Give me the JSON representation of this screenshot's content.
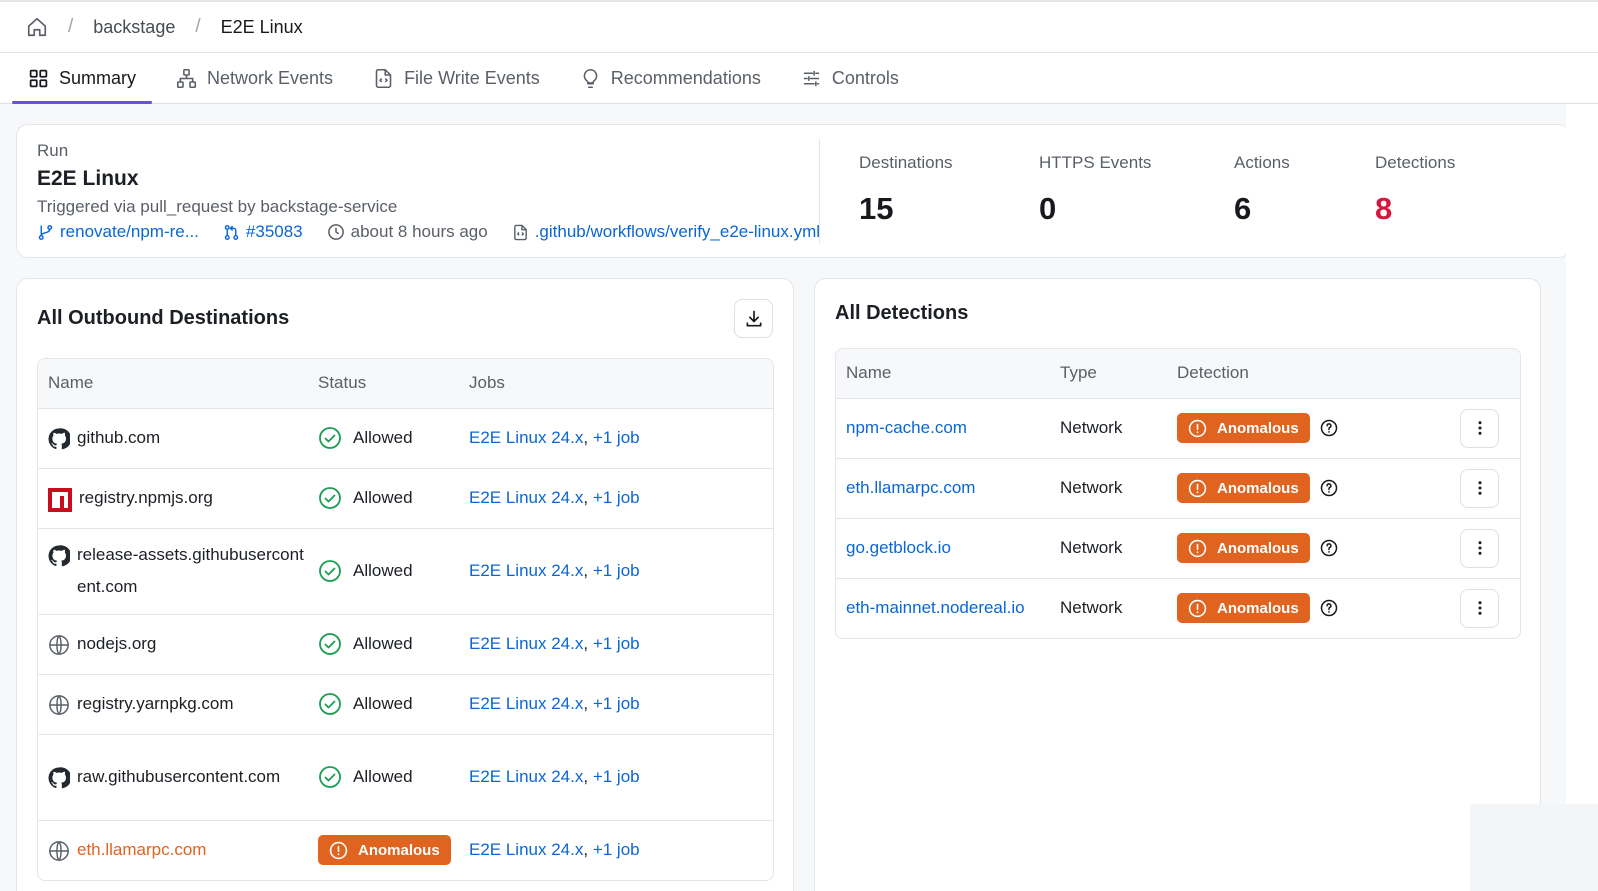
{
  "breadcrumb": {
    "items": [
      "backstage",
      "E2E Linux"
    ],
    "separator": "/"
  },
  "tabs": [
    {
      "label": "Summary",
      "icon": "grid-icon",
      "active": true
    },
    {
      "label": "Network Events",
      "icon": "network-icon",
      "active": false
    },
    {
      "label": "File Write Events",
      "icon": "file-code-icon",
      "active": false
    },
    {
      "label": "Recommendations",
      "icon": "lightbulb-icon",
      "active": false
    },
    {
      "label": "Controls",
      "icon": "sliders-icon",
      "active": false
    }
  ],
  "run": {
    "label": "Run",
    "title": "E2E Linux",
    "trigger": "Triggered via pull_request by backstage-service",
    "branch": "renovate/npm-re...",
    "pr": "#35083",
    "time": "about 8 hours ago",
    "workflow": ".github/workflows/verify_e2e-linux.yml"
  },
  "stats": [
    {
      "label": "Destinations",
      "value": "15",
      "color": "#17191d"
    },
    {
      "label": "HTTPS Events",
      "value": "0",
      "color": "#17191d"
    },
    {
      "label": "Actions",
      "value": "6",
      "color": "#17191d"
    },
    {
      "label": "Detections",
      "value": "8",
      "color": "#d4183d"
    }
  ],
  "destinations": {
    "title": "All Outbound Destinations",
    "columns": [
      "Name",
      "Status",
      "Jobs"
    ],
    "rows": [
      {
        "name": "github.com",
        "icon": "github-icon",
        "status": "Allowed",
        "job": "E2E Linux 24.x",
        "more": "+1 job"
      },
      {
        "name": "registry.npmjs.org",
        "icon": "npm-icon",
        "status": "Allowed",
        "job": "E2E Linux 24.x",
        "more": "+1 job"
      },
      {
        "name": "release-assets.githubusercontent.com",
        "icon": "github-icon",
        "status": "Allowed",
        "job": "E2E Linux 24.x",
        "more": "+1 job"
      },
      {
        "name": "nodejs.org",
        "icon": "globe-icon",
        "status": "Allowed",
        "job": "E2E Linux 24.x",
        "more": "+1 job"
      },
      {
        "name": "registry.yarnpkg.com",
        "icon": "globe-icon",
        "status": "Allowed",
        "job": "E2E Linux 24.x",
        "more": "+1 job"
      },
      {
        "name": "raw.githubusercontent.com",
        "icon": "github-icon",
        "status": "Allowed",
        "job": "E2E Linux 24.x",
        "more": "+1 job"
      },
      {
        "name": "eth.llamarpc.com",
        "icon": "globe-icon",
        "status": "Anomalous",
        "job": "E2E Linux 24.x",
        "more": "+1 job"
      }
    ]
  },
  "detections": {
    "title": "All Detections",
    "columns": [
      "Name",
      "Type",
      "Detection"
    ],
    "rows": [
      {
        "name": "npm-cache.com",
        "type": "Network",
        "detection": "Anomalous"
      },
      {
        "name": "eth.llamarpc.com",
        "type": "Network",
        "detection": "Anomalous"
      },
      {
        "name": "go.getblock.io",
        "type": "Network",
        "detection": "Anomalous"
      },
      {
        "name": "eth-mainnet.nodereal.io",
        "type": "Network",
        "detection": "Anomalous"
      }
    ]
  },
  "colors": {
    "accent": "#6b4fe0",
    "link": "#0a66d6",
    "anomalous": "#e0631f",
    "allowed": "#1a9e52",
    "danger": "#d4183d"
  }
}
